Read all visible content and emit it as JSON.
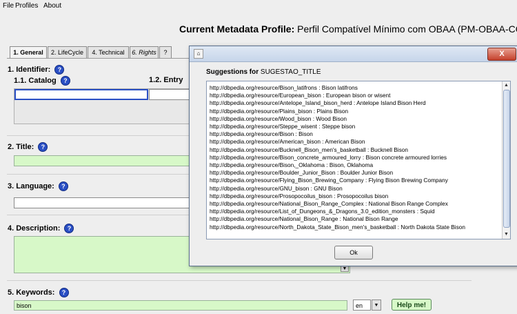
{
  "menu": {
    "items": [
      "File",
      "Profiles",
      "About"
    ]
  },
  "profile": {
    "label": "Current Metadata Profile:",
    "name": "Perfil Compatível Mínimo com OBAA (PM-OBAA-CORE)"
  },
  "tabs": [
    {
      "label": "1. General"
    },
    {
      "label": "2. LifeCycle"
    },
    {
      "label": "4. Technical"
    },
    {
      "label": "6. Rights"
    },
    {
      "label": "?"
    }
  ],
  "identifier": {
    "label": "1. Identifier:",
    "catalog_label": "1.1. Catalog",
    "entry_label": "1.2. Entry"
  },
  "title": {
    "label": "2. Title:",
    "value": ""
  },
  "language": {
    "label": "3. Language:",
    "value": ""
  },
  "description": {
    "label": "4. Description:",
    "value": ""
  },
  "keywords": {
    "label": "5. Keywords:",
    "value": "bison",
    "lang": "en",
    "help_button": "Help me!"
  },
  "help_icon_glyph": "?",
  "dialog": {
    "heading_label": "Suggestions for",
    "heading_field": "SUGESTAO_TITLE",
    "ok_label": "Ok",
    "close_glyph": "X",
    "suggestions": [
      "http://dbpedia.org/resource/Bison_latifrons : Bison latifrons",
      "http://dbpedia.org/resource/European_bison : European bison or wisent",
      "http://dbpedia.org/resource/Antelope_Island_bison_herd : Antelope Island Bison Herd",
      "http://dbpedia.org/resource/Plains_bison : Plains Bison",
      "http://dbpedia.org/resource/Wood_bison : Wood Bison",
      "http://dbpedia.org/resource/Steppe_wisent : Steppe bison",
      "http://dbpedia.org/resource/Bison : Bison",
      "http://dbpedia.org/resource/American_bison : American Bison",
      "http://dbpedia.org/resource/Bucknell_Bison_men's_basketball : Bucknell Bison",
      "http://dbpedia.org/resource/Bison_concrete_armoured_lorry : Bison concrete armoured lorries",
      "http://dbpedia.org/resource/Bison,_Oklahoma : Bison, Oklahoma",
      "http://dbpedia.org/resource/Boulder_Junior_Bison : Boulder Junior Bison",
      "http://dbpedia.org/resource/Flying_Bison_Brewing_Company : Flying Bison Brewing Company",
      "http://dbpedia.org/resource/GNU_bison : GNU Bison",
      "http://dbpedia.org/resource/Prosopocoilus_bison : Prosopocoilus bison",
      "http://dbpedia.org/resource/National_Bison_Range_Complex : National Bison Range Complex",
      "http://dbpedia.org/resource/List_of_Dungeons_&_Dragons_3.0_edition_monsters : Squid",
      "http://dbpedia.org/resource/National_Bison_Range : National Bison Range",
      "http://dbpedia.org/resource/North_Dakota_State_Bison_men's_basketball : North Dakota State Bison"
    ]
  }
}
